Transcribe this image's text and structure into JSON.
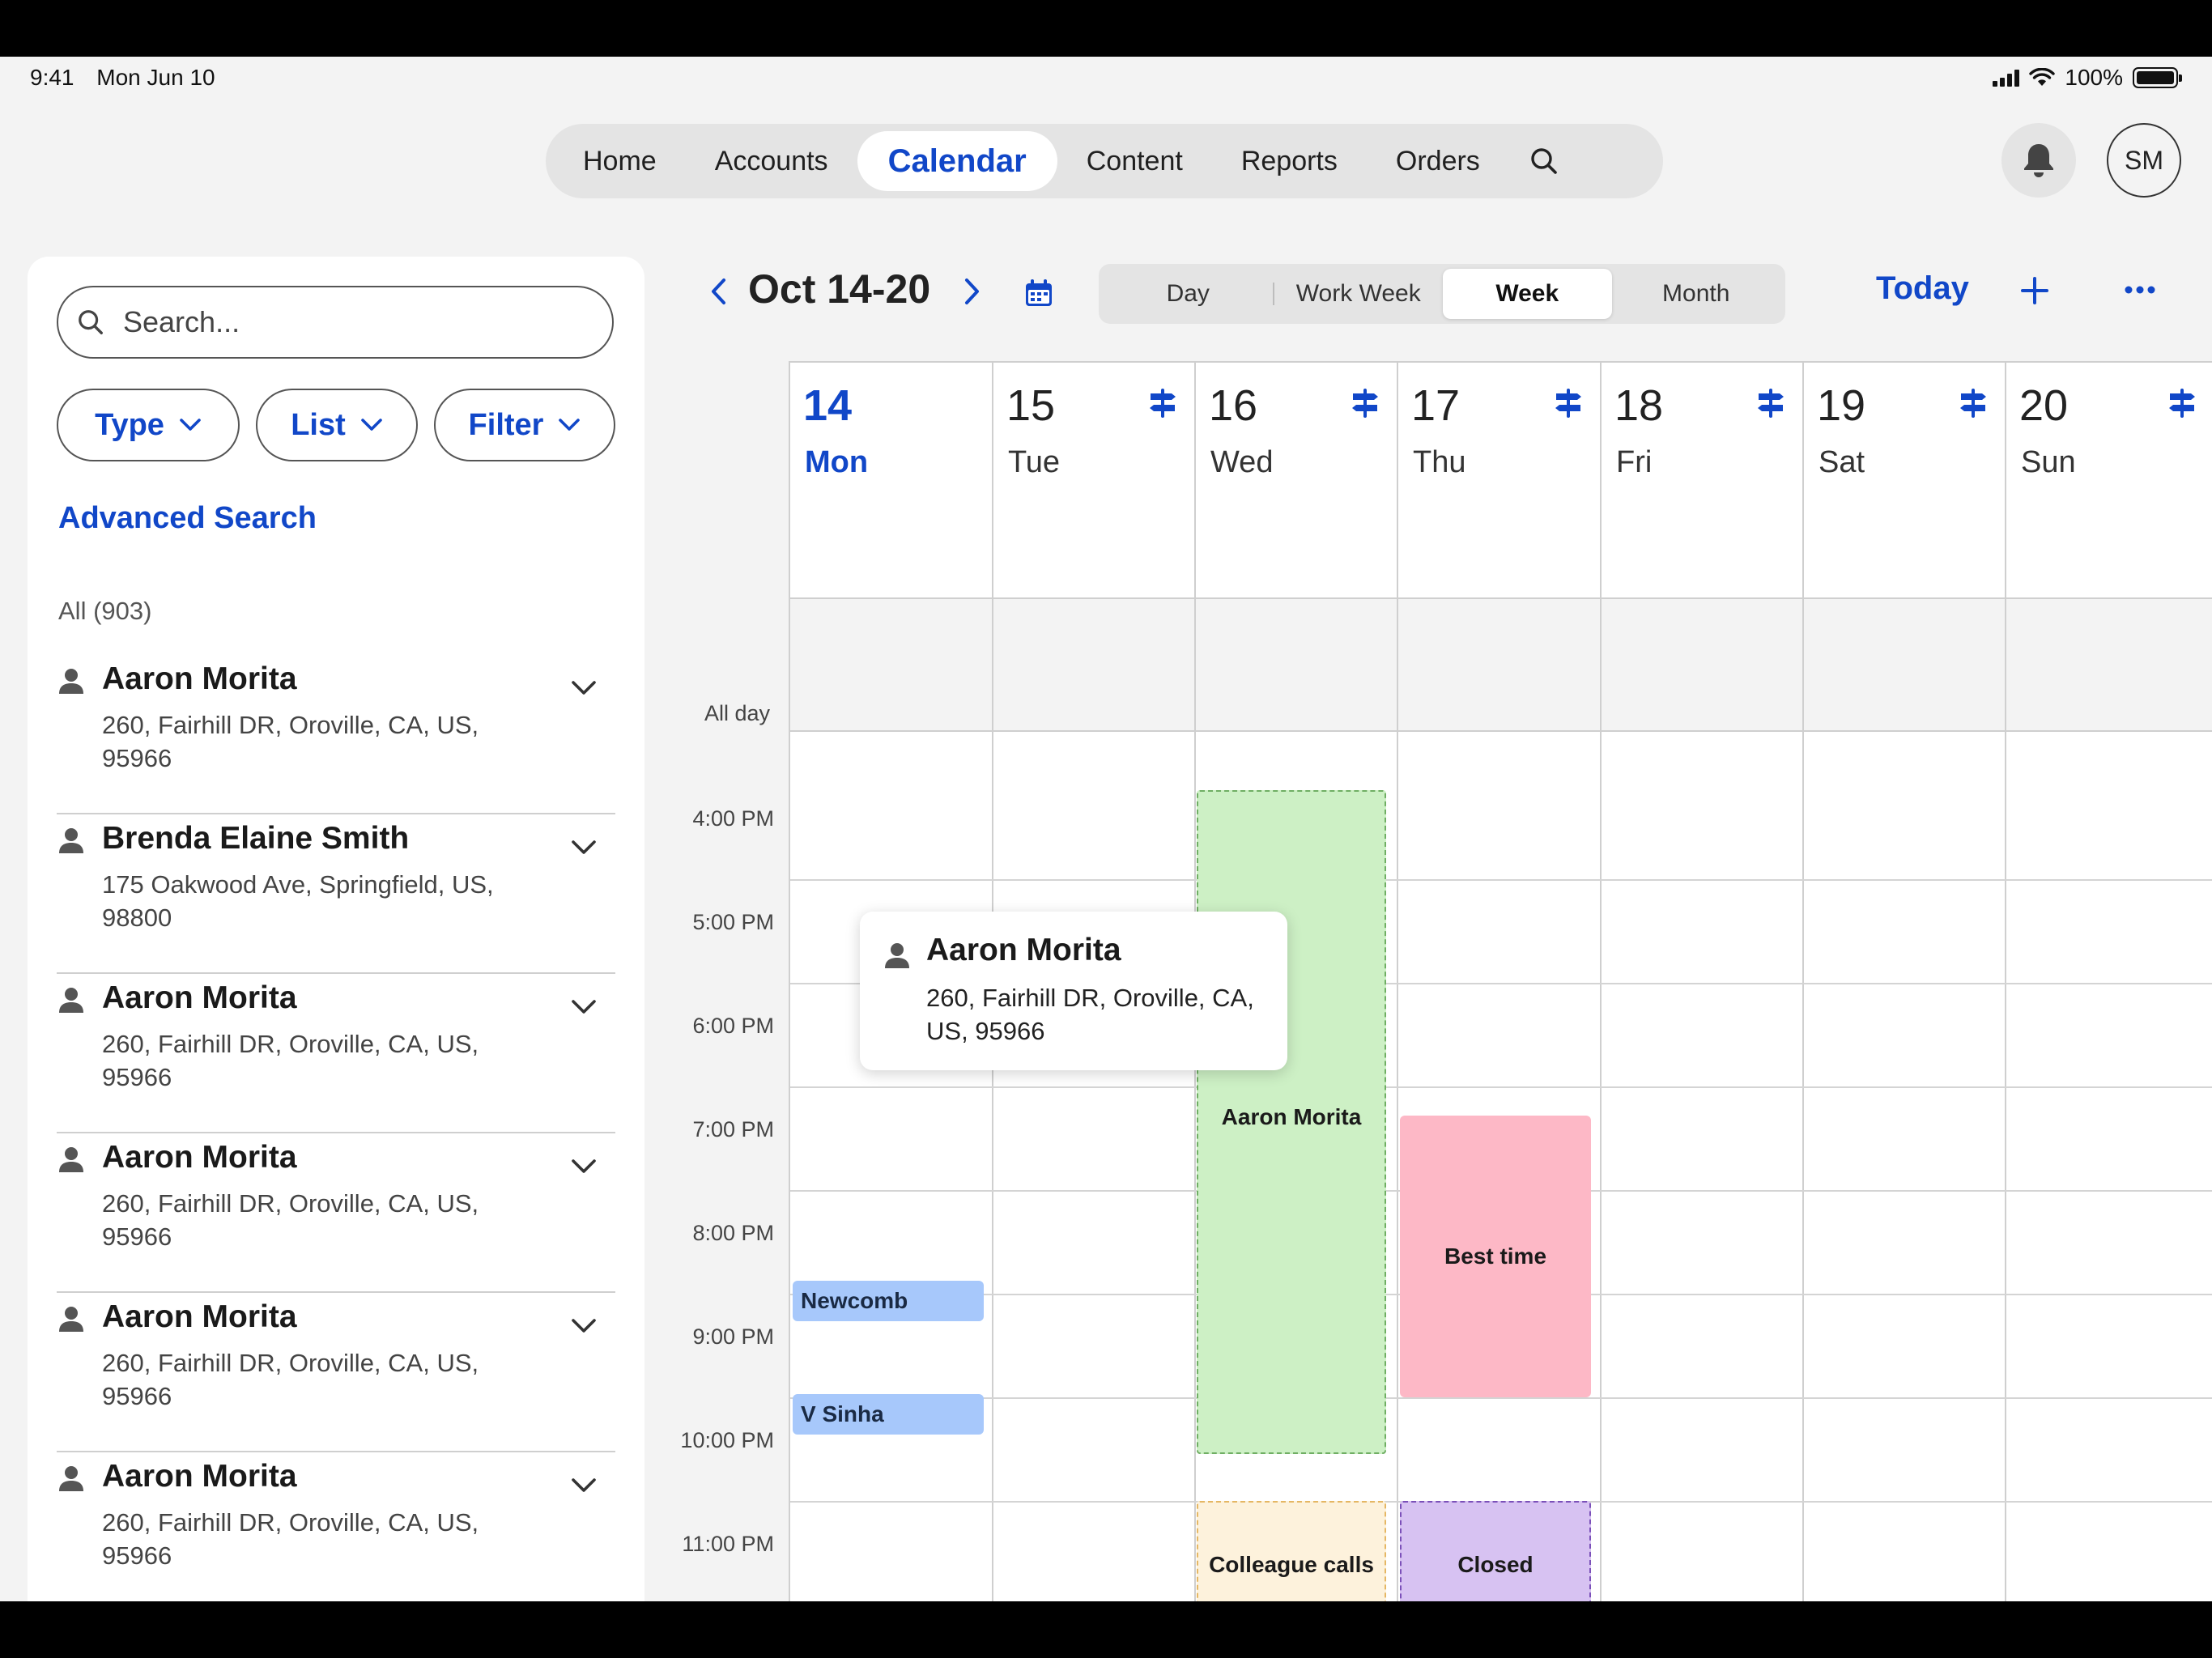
{
  "status": {
    "time": "9:41",
    "date": "Mon Jun 10",
    "battery": "100%"
  },
  "nav": {
    "items": [
      "Home",
      "Accounts",
      "Calendar",
      "Content",
      "Reports",
      "Orders"
    ],
    "active": "Calendar",
    "avatar_initials": "SM"
  },
  "sidebar": {
    "search_placeholder": "Search...",
    "chips": [
      "Type",
      "List",
      "Filter"
    ],
    "advanced_search": "Advanced Search",
    "all_count": "All (903)",
    "items": [
      {
        "name": "Aaron Morita",
        "address": "260, Fairhill DR, Oroville, CA, US, 95966"
      },
      {
        "name": "Brenda Elaine Smith",
        "address": "175 Oakwood Ave, Springfield, US, 98800"
      },
      {
        "name": "Aaron Morita",
        "address": "260, Fairhill DR, Oroville, CA, US, 95966"
      },
      {
        "name": "Aaron Morita",
        "address": "260, Fairhill DR, Oroville, CA, US, 95966"
      },
      {
        "name": "Aaron Morita",
        "address": "260, Fairhill DR, Oroville, CA, US, 95966"
      },
      {
        "name": "Aaron Morita",
        "address": "260, Fairhill DR, Oroville, CA, US, 95966"
      }
    ]
  },
  "calendar": {
    "range": "Oct 14-20",
    "views": [
      "Day",
      "Work Week",
      "Week",
      "Month"
    ],
    "active_view": "Week",
    "today_label": "Today",
    "all_day_label": "All day",
    "days": [
      {
        "num": "14",
        "name": "Mon",
        "today": true
      },
      {
        "num": "15",
        "name": "Tue"
      },
      {
        "num": "16",
        "name": "Wed"
      },
      {
        "num": "17",
        "name": "Thu"
      },
      {
        "num": "18",
        "name": "Fri"
      },
      {
        "num": "19",
        "name": "Sat"
      },
      {
        "num": "20",
        "name": "Sun"
      }
    ],
    "times": [
      "4:00 PM",
      "5:00 PM",
      "6:00 PM",
      "7:00 PM",
      "8:00 PM",
      "9:00 PM",
      "10:00 PM",
      "11:00 PM"
    ],
    "events": [
      {
        "title": "Newcomb",
        "day": "Mon",
        "style": "blue"
      },
      {
        "title": "V Sinha",
        "day": "Mon",
        "style": "blue"
      },
      {
        "title": "Aaron Morita",
        "day": "Wed",
        "style": "green"
      },
      {
        "title": "Best time",
        "day": "Thu",
        "style": "pink"
      },
      {
        "title": "Colleague calls",
        "day": "Wed",
        "style": "cream"
      },
      {
        "title": "Closed",
        "day": "Thu",
        "style": "purple"
      }
    ],
    "popover": {
      "name": "Aaron Morita",
      "address": "260, Fairhill DR, Oroville, CA, US, 95966"
    }
  }
}
